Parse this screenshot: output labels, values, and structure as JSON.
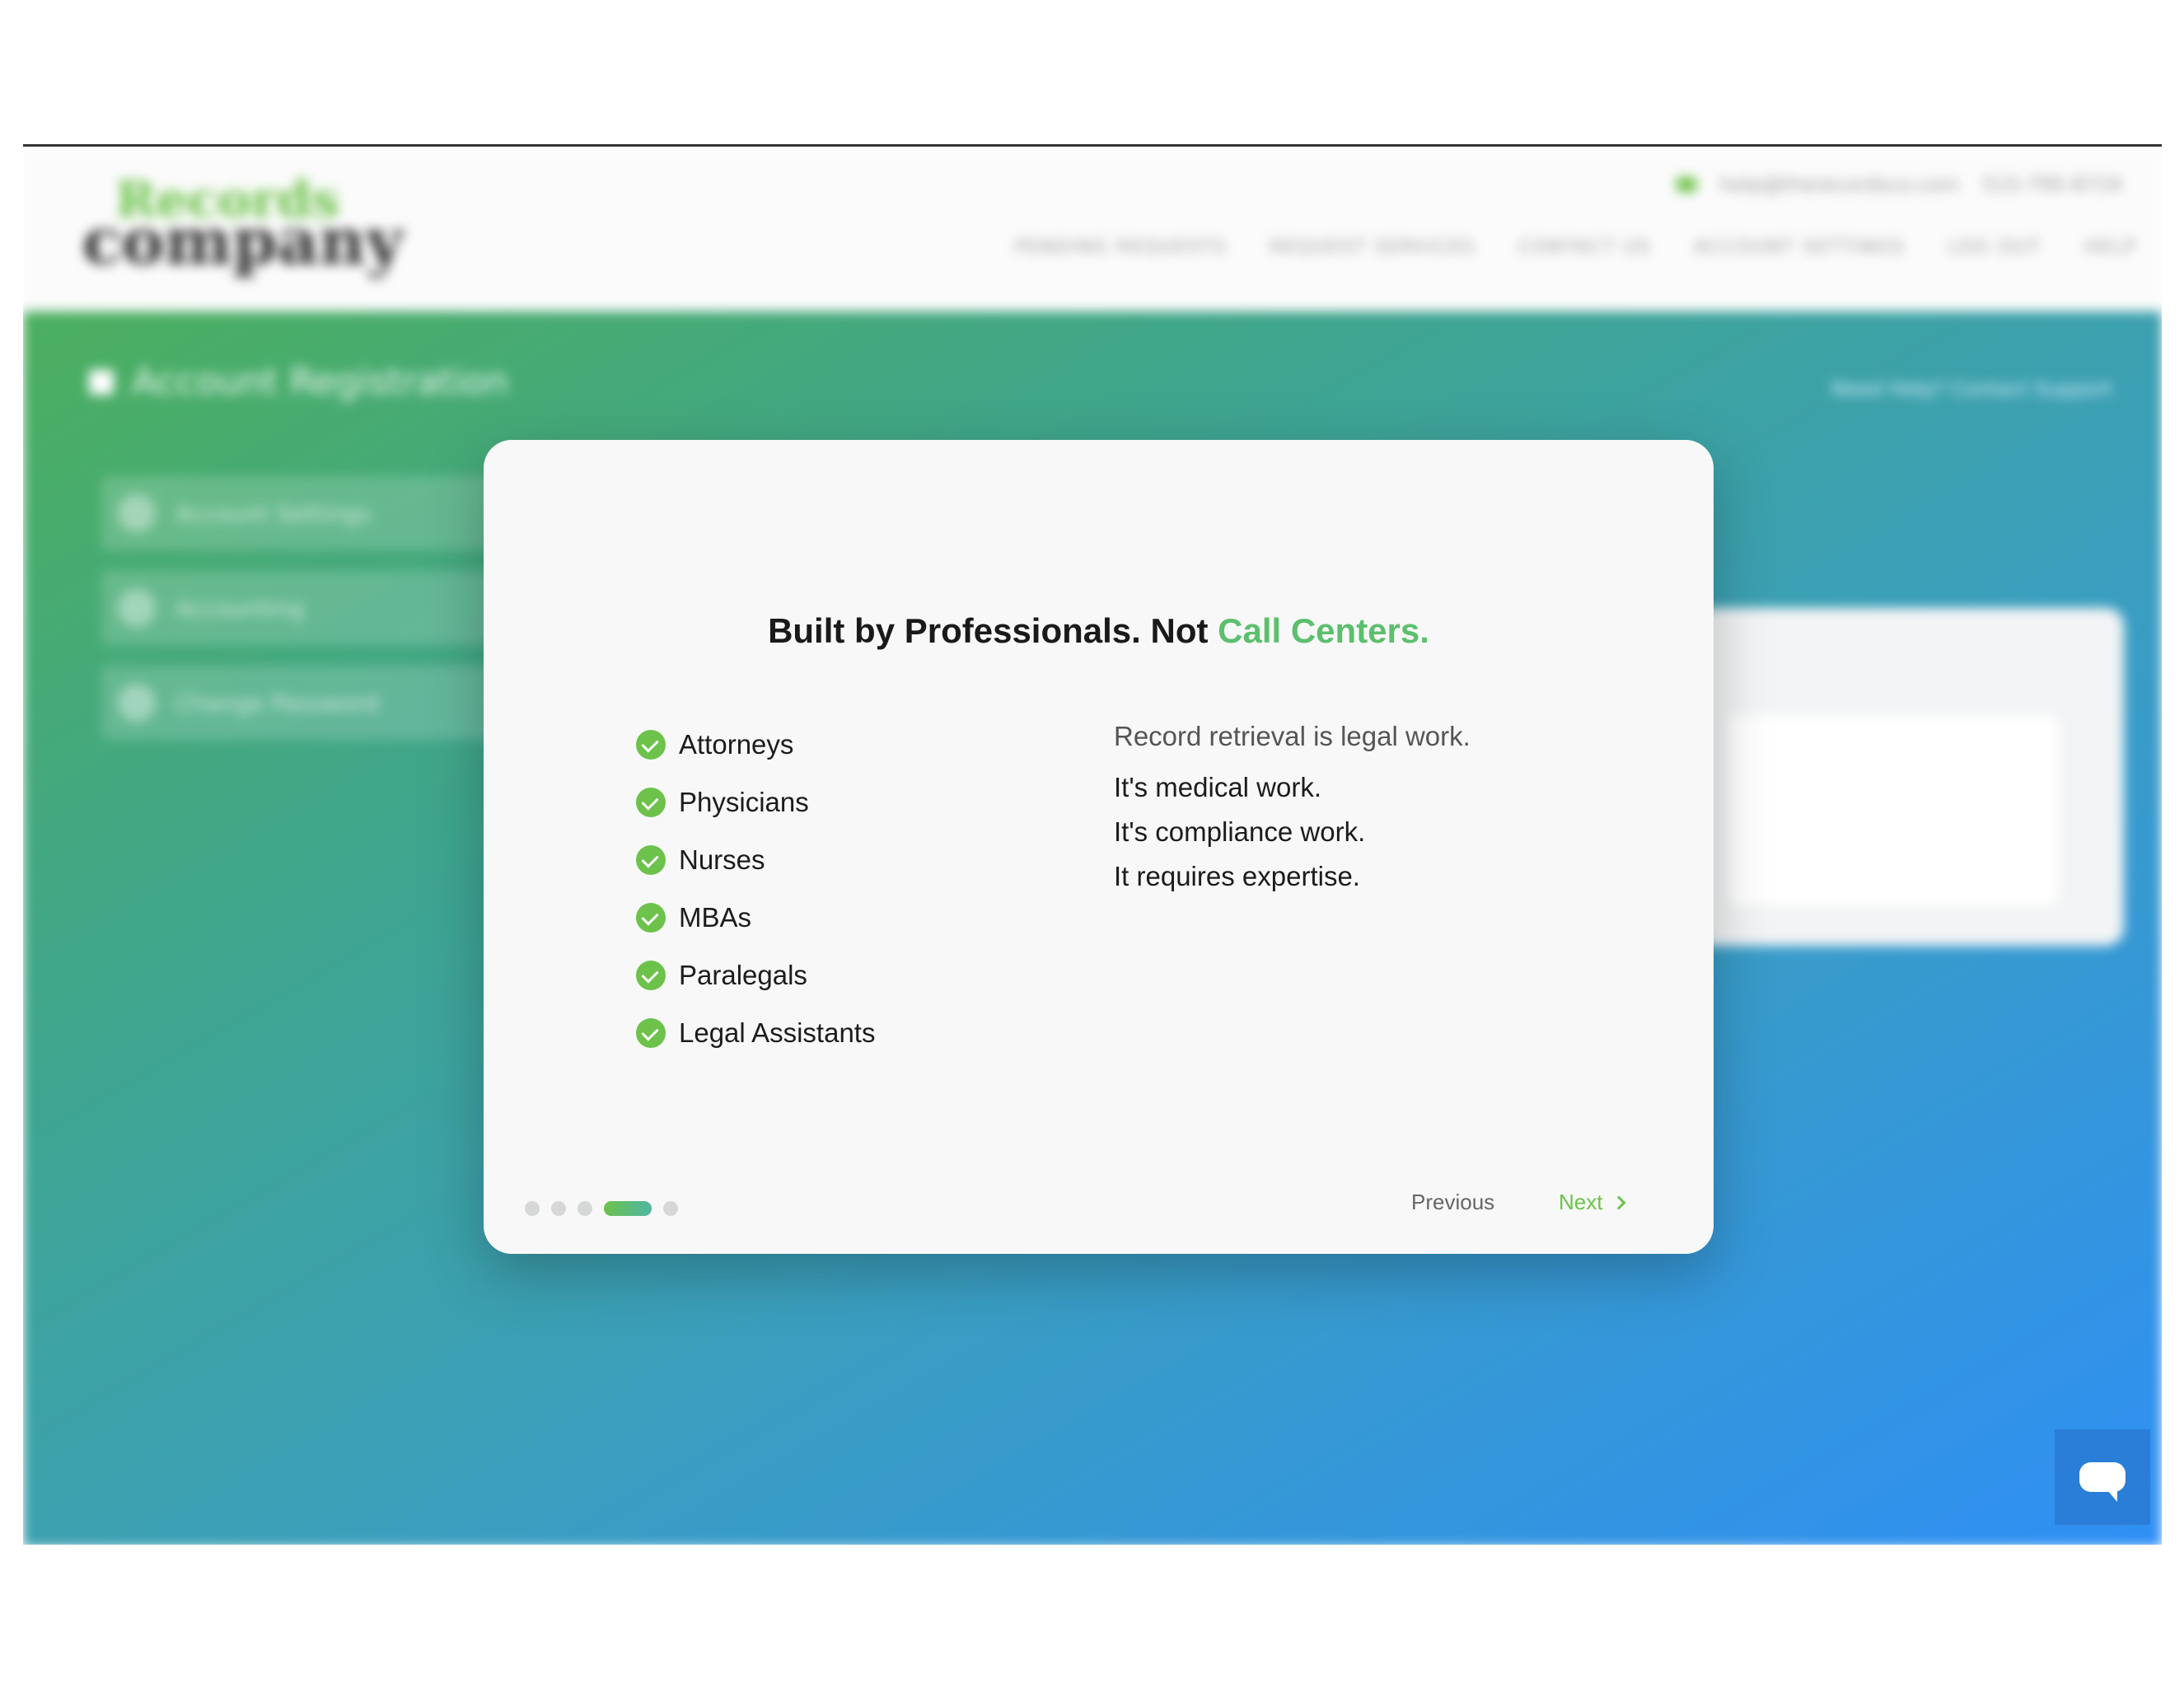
{
  "background": {
    "logo": {
      "line1": "Records",
      "line2": "company"
    },
    "contact": {
      "email": "help@therecordsco.com",
      "phone": "515-795-8724"
    },
    "nav": [
      "PENDING REQUESTS",
      "REQUEST SERVICES",
      "CONTACT US",
      "ACCOUNT SETTINGS",
      "LOG OUT",
      "HELP"
    ],
    "page_title": "Account Registration",
    "help_text": "Need Help? Contact Support",
    "sidebar": [
      "Account Settings",
      "Accounting",
      "Change Password"
    ]
  },
  "modal": {
    "title_main": "Built by Professionals. Not ",
    "title_accent": "Call Centers.",
    "checklist": [
      "Attorneys",
      "Physicians",
      "Nurses",
      "MBAs",
      "Paralegals",
      "Legal Assistants"
    ],
    "lead": "Record retrieval is legal work.",
    "lines": [
      "It's medical work.",
      "It's compliance work.",
      "It requires expertise."
    ],
    "pagination": {
      "total": 5,
      "current": 4
    },
    "previous_label": "Previous",
    "next_label": "Next"
  },
  "colors": {
    "accent": "#6cc24a",
    "accent_text": "#5cbf6e",
    "chat": "#2a7ed8"
  }
}
